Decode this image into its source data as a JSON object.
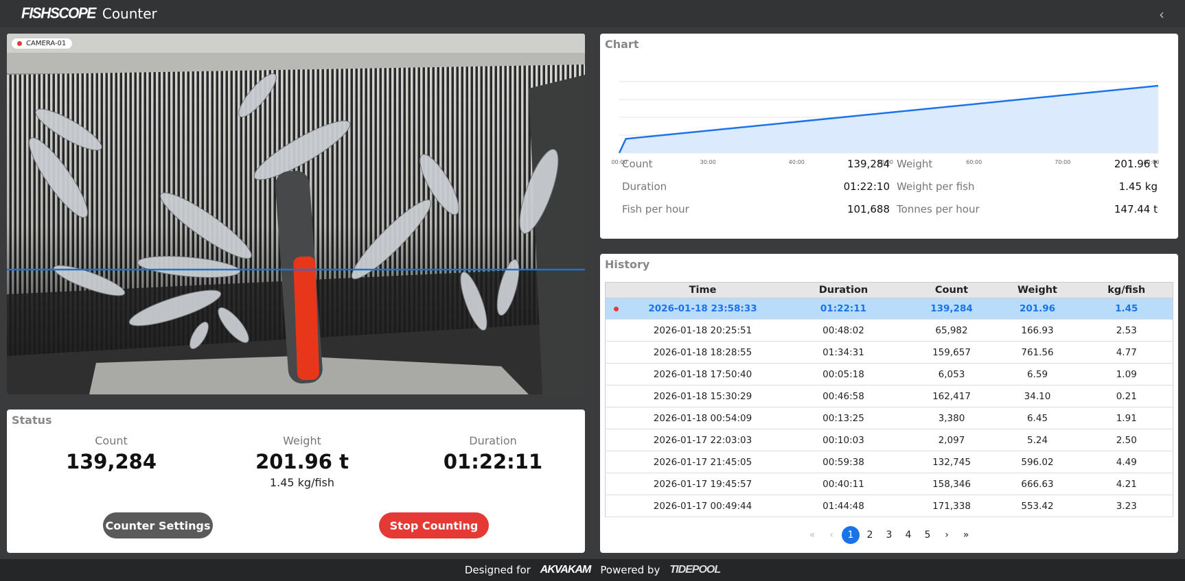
{
  "app": {
    "logo": "FISHSCOPE",
    "title": "Counter",
    "collapse": "‹"
  },
  "camera": {
    "name": "CAMERA-01"
  },
  "status": {
    "title": "Status",
    "count_label": "Count",
    "count_value": "139,284",
    "weight_label": "Weight",
    "weight_value": "201.96 t",
    "weight_sub": "1.45 kg/fish",
    "duration_label": "Duration",
    "duration_value": "01:22:11",
    "settings_button": "Counter Settings",
    "stop_button": "Stop Counting"
  },
  "chart": {
    "title": "Chart",
    "metrics": [
      {
        "k1": "Count",
        "v1": "139,284",
        "k2": "Weight",
        "v2": "201.96 t"
      },
      {
        "k1": "Duration",
        "v1": "01:22:10",
        "k2": "Weight per fish",
        "v2": "1.45 kg"
      },
      {
        "k1": "Fish per hour",
        "v1": "101,688",
        "k2": "Tonnes per hour",
        "v2": "147.44 t"
      }
    ]
  },
  "chart_data": {
    "type": "area",
    "x_ticks": [
      "00:00",
      "30:00",
      "40:00",
      "50:00",
      "60:00",
      "70:00",
      "80:00"
    ],
    "x": [
      0,
      1,
      82
    ],
    "y": [
      0,
      0.21,
      1.0
    ],
    "title": "",
    "xlabel": "",
    "ylabel": "",
    "grid": true,
    "colors": {
      "line": "#1a73e8",
      "fill": "#dbeafd"
    }
  },
  "history": {
    "title": "History",
    "columns": [
      "",
      "Time",
      "Duration",
      "Count",
      "Weight",
      "kg/fish"
    ],
    "rows": [
      [
        "2026-01-18 23:58:33",
        "01:22:11",
        "139,284",
        "201.96",
        "1.45"
      ],
      [
        "2026-01-18 20:25:51",
        "00:48:02",
        "65,982",
        "166.93",
        "2.53"
      ],
      [
        "2026-01-18 18:28:55",
        "01:34:31",
        "159,657",
        "761.56",
        "4.77"
      ],
      [
        "2026-01-18 17:50:40",
        "00:05:18",
        "6,053",
        "6.59",
        "1.09"
      ],
      [
        "2026-01-18 15:30:29",
        "00:46:58",
        "162,417",
        "34.10",
        "0.21"
      ],
      [
        "2026-01-18 00:54:09",
        "00:13:25",
        "3,380",
        "6.45",
        "1.91"
      ],
      [
        "2026-01-17 22:03:03",
        "00:10:03",
        "2,097",
        "5.24",
        "2.50"
      ],
      [
        "2026-01-17 21:45:05",
        "00:59:38",
        "132,745",
        "596.02",
        "4.49"
      ],
      [
        "2026-01-17 19:45:57",
        "00:40:11",
        "158,346",
        "666.63",
        "4.21"
      ],
      [
        "2026-01-17 00:49:44",
        "01:44:48",
        "171,338",
        "553.42",
        "3.23"
      ]
    ],
    "pager": {
      "first": "«",
      "prev": "‹",
      "pages": [
        "1",
        "2",
        "3",
        "4",
        "5"
      ],
      "next": "›",
      "last": "»",
      "current": "1"
    }
  },
  "footer": {
    "designed_for": "Designed for",
    "brand1": "AKVAKAM",
    "powered_by": "Powered by",
    "brand2": "TIDEPOOL"
  }
}
